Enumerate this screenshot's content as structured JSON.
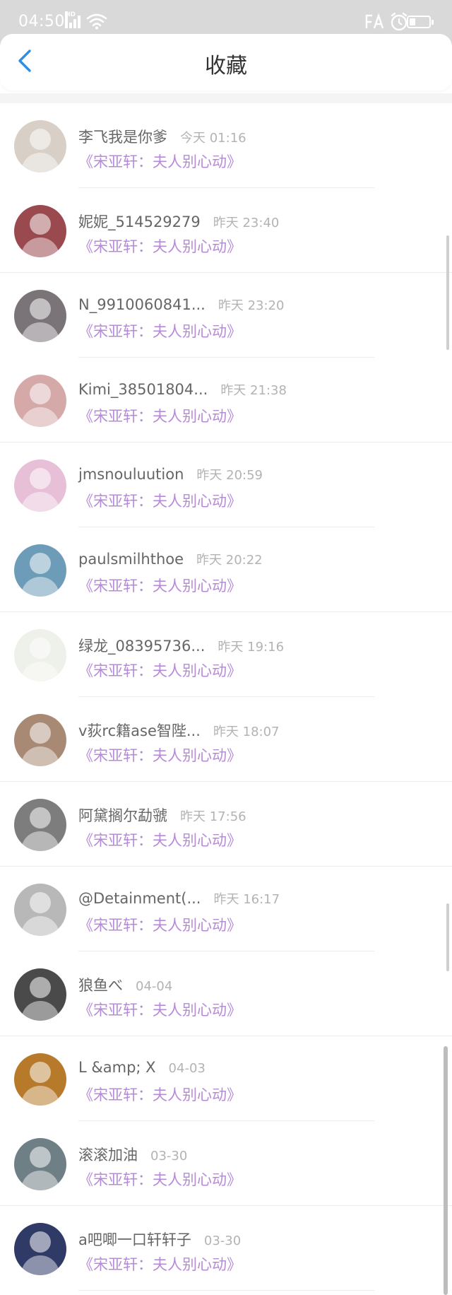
{
  "status_bar": {
    "time": "04:50",
    "signal_tag": "HD",
    "icons": [
      "signal-icon",
      "wifi-icon",
      "nfc-icon",
      "alarm-icon",
      "battery-icon"
    ],
    "battery_level": 0.3
  },
  "header": {
    "title": "收藏"
  },
  "colors": {
    "accent": "#2d8ce6",
    "book_title": "#b58ad6",
    "name": "#666666",
    "time": "#b3b3b3"
  },
  "favorites": [
    {
      "name": "李飞我是你爹",
      "time": "今天 01:16",
      "book": "《宋亚轩：夫人别心动》",
      "avatar_color": "#d8cfc6"
    },
    {
      "name": "妮妮_514529279",
      "time": "昨天 23:40",
      "book": "《宋亚轩：夫人别心动》",
      "avatar_color": "#9a4a4e"
    },
    {
      "name": "N_9910060841...",
      "time": "昨天 23:20",
      "book": "《宋亚轩：夫人别心动》",
      "avatar_color": "#7a7378"
    },
    {
      "name": "Kimi_38501804...",
      "time": "昨天 21:38",
      "book": "《宋亚轩：夫人别心动》",
      "avatar_color": "#d6a9a9"
    },
    {
      "name": "jmsnouluution",
      "time": "昨天 20:59",
      "book": "《宋亚轩：夫人别心动》",
      "avatar_color": "#e7c0d8"
    },
    {
      "name": "paulsmilhthoe",
      "time": "昨天 20:22",
      "book": "《宋亚轩：夫人别心动》",
      "avatar_color": "#6d9cb8"
    },
    {
      "name": "绿龙_08395736...",
      "time": "昨天 19:16",
      "book": "《宋亚轩：夫人别心动》",
      "avatar_color": "#eef0ea"
    },
    {
      "name": "v荻rc籍ase智陛...",
      "time": "昨天 18:07",
      "book": "《宋亚轩：夫人别心动》",
      "avatar_color": "#a88a74"
    },
    {
      "name": "阿黛搁尔勐虢",
      "time": "昨天 17:56",
      "book": "《宋亚轩：夫人别心动》",
      "avatar_color": "#7d7d7d"
    },
    {
      "name": "@Detainment(...",
      "time": "昨天 16:17",
      "book": "《宋亚轩：夫人别心动》",
      "avatar_color": "#b8b8b8"
    },
    {
      "name": "狼鱼べ",
      "time": "04-04",
      "book": "《宋亚轩：夫人别心动》",
      "avatar_color": "#4a4a4a"
    },
    {
      "name": "L &amp; X",
      "time": "04-03",
      "book": "《宋亚轩：夫人别心动》",
      "avatar_color": "#b77a2a"
    },
    {
      "name": "滚滚加油",
      "time": "03-30",
      "book": "《宋亚轩：夫人别心动》",
      "avatar_color": "#6f7f86"
    },
    {
      "name": "a吧唧一口轩轩子",
      "time": "03-30",
      "book": "《宋亚轩：夫人别心动》",
      "avatar_color": "#2f3a66"
    }
  ]
}
